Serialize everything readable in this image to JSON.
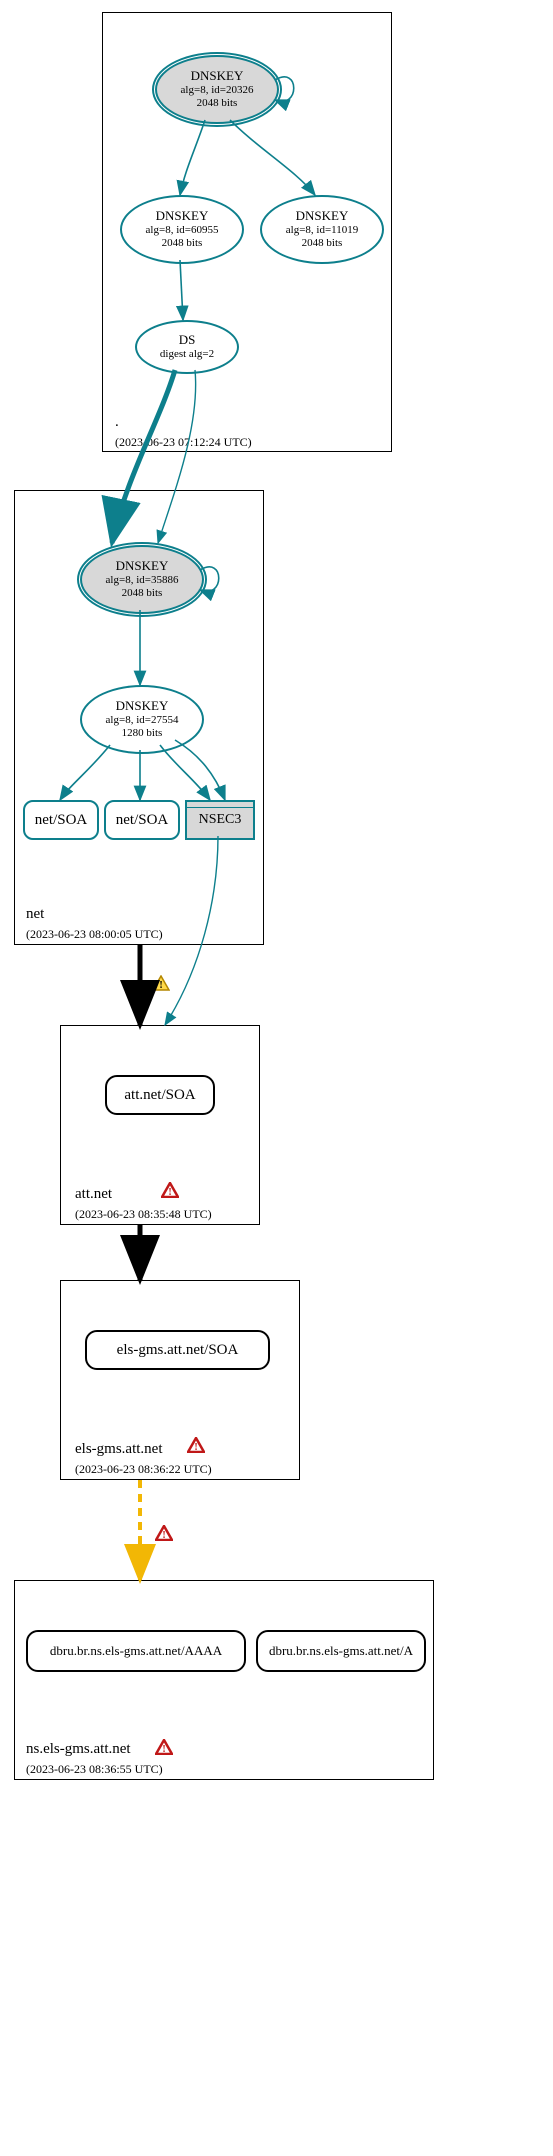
{
  "zones": {
    "root": {
      "name": ".",
      "ts": "(2023-06-23 07:12:24 UTC)"
    },
    "net": {
      "name": "net",
      "ts": "(2023-06-23 08:00:05 UTC)"
    },
    "att": {
      "name": "att.net",
      "ts": "(2023-06-23 08:35:48 UTC)"
    },
    "els": {
      "name": "els-gms.att.net",
      "ts": "(2023-06-23 08:36:22 UTC)"
    },
    "ns": {
      "name": "ns.els-gms.att.net",
      "ts": "(2023-06-23 08:36:55 UTC)"
    }
  },
  "nodes": {
    "dnskey1": {
      "l1": "DNSKEY",
      "l2": "alg=8, id=20326",
      "l3": "2048 bits"
    },
    "dnskey2": {
      "l1": "DNSKEY",
      "l2": "alg=8, id=60955",
      "l3": "2048 bits"
    },
    "dnskey3": {
      "l1": "DNSKEY",
      "l2": "alg=8, id=11019",
      "l3": "2048 bits"
    },
    "ds1": {
      "l1": "DS",
      "l2": "digest alg=2"
    },
    "dnskey4": {
      "l1": "DNSKEY",
      "l2": "alg=8, id=35886",
      "l3": "2048 bits"
    },
    "dnskey5": {
      "l1": "DNSKEY",
      "l2": "alg=8, id=27554",
      "l3": "1280 bits"
    },
    "soa1": {
      "label": "net/SOA"
    },
    "soa2": {
      "label": "net/SOA"
    },
    "nsec3": {
      "label": "NSEC3"
    },
    "attsoa": {
      "label": "att.net/SOA"
    },
    "elssoa": {
      "label": "els-gms.att.net/SOA"
    },
    "aaaa": {
      "label": "dbru.br.ns.els-gms.att.net/AAAA"
    },
    "a": {
      "label": "dbru.br.ns.els-gms.att.net/A"
    }
  },
  "icons": {
    "warn_yellow": "warning",
    "warn_red": "error"
  },
  "colors": {
    "teal": "#0d7f8c",
    "yellow": "#f2b705",
    "red": "#c01818",
    "grey": "#d8d8d8"
  }
}
